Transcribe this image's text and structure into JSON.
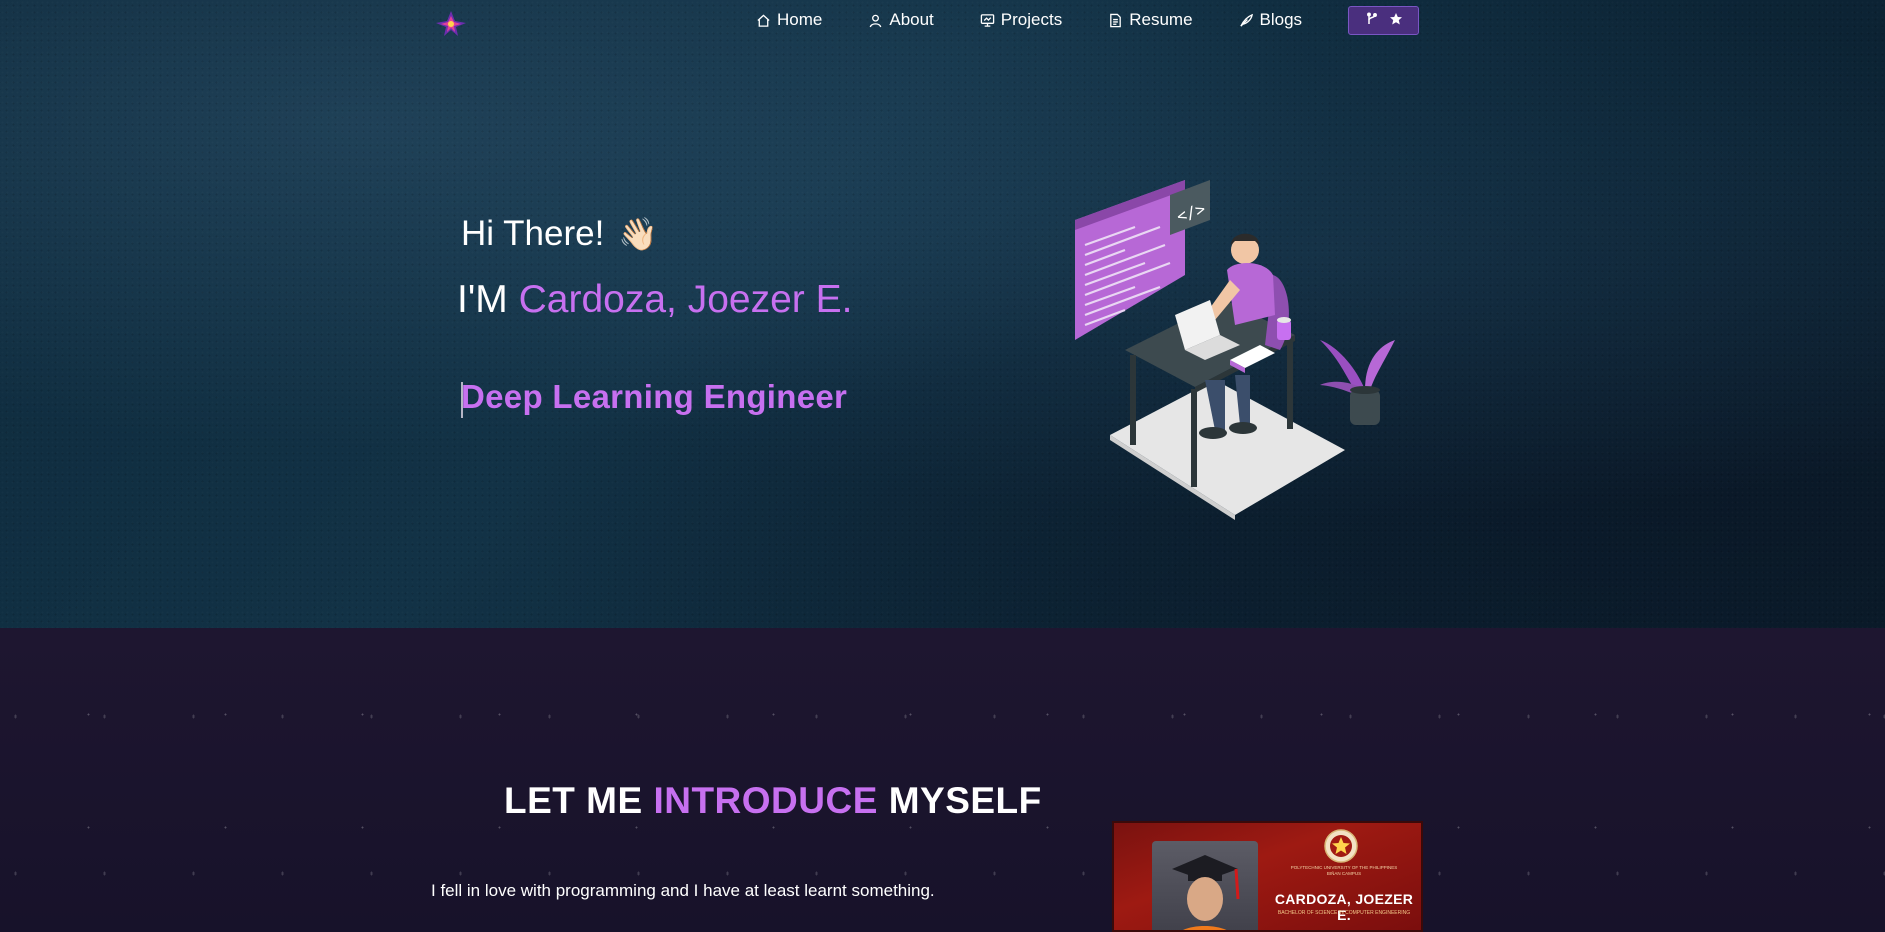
{
  "nav": {
    "logo": "site-logo",
    "items": [
      {
        "label": "Home",
        "icon": "home-icon"
      },
      {
        "label": "About",
        "icon": "user-icon"
      },
      {
        "label": "Projects",
        "icon": "presentation-icon"
      },
      {
        "label": "Resume",
        "icon": "document-icon"
      },
      {
        "label": "Blogs",
        "icon": "feather-icon"
      }
    ],
    "github_button": {
      "icons": [
        "git-fork-icon",
        "star-icon"
      ]
    }
  },
  "hero": {
    "greeting": "Hi There!",
    "wave_emoji": "👋🏻",
    "iam_prefix": "I'M",
    "name": "Cardoza, Joezer E.",
    "role": "Deep Learning Engineer"
  },
  "about": {
    "title_part1": "LET ME",
    "title_highlight": "INTRODUCE",
    "title_part2": "MYSELF",
    "intro": "I fell in love with programming and I have at least learnt something.",
    "grad_card": {
      "university": "POLYTECHNIC UNIVERSITY OF THE PHILIPPINES BIÑAN CAMPUS",
      "name": "CARDOZA, JOEZER E.",
      "degree": "BACHELOR OF SCIENCE IN COMPUTER ENGINEERING"
    }
  },
  "colors": {
    "accent": "#c770f0",
    "hero_bg": "#0e2a3c",
    "about_bg": "#1b1428",
    "button_bg": "#4a2f7e"
  }
}
